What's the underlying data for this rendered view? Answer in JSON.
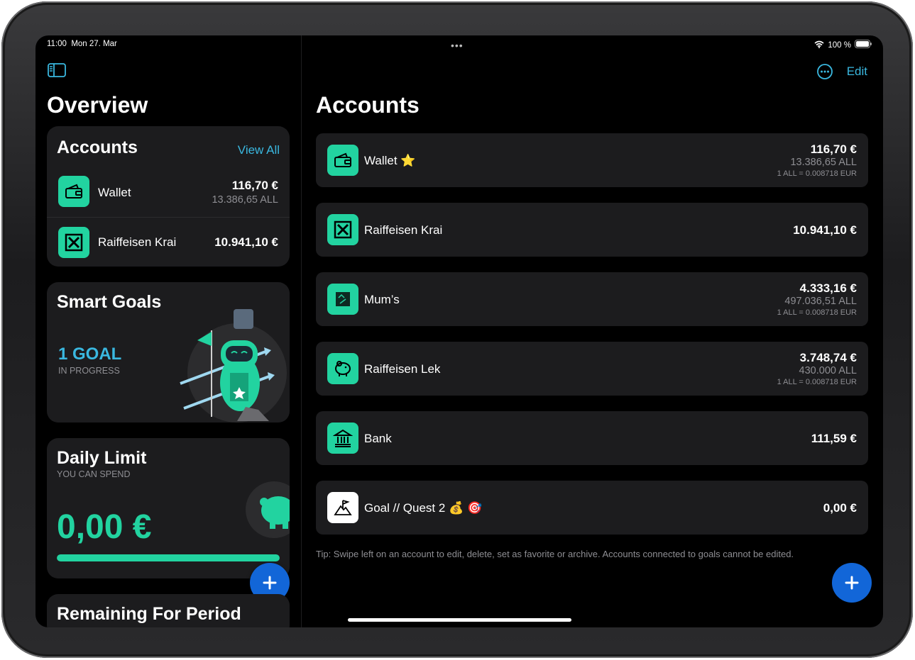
{
  "status": {
    "time": "11:00",
    "date": "Mon 27. Mar",
    "battery": "100 %"
  },
  "sidebar": {
    "title": "Overview",
    "accounts_card": {
      "title": "Accounts",
      "view_all": "View All",
      "items": [
        {
          "name": "Wallet",
          "amount": "116,70 €",
          "sub": "13.386,65 ALL"
        },
        {
          "name": "Raiffeisen Krai",
          "amount": "10.941,10 €"
        }
      ]
    },
    "smart_goals": {
      "title": "Smart Goals",
      "count": "1 GOAL",
      "status": "IN PROGRESS"
    },
    "daily_limit": {
      "title": "Daily Limit",
      "subtitle": "YOU CAN SPEND",
      "amount": "0,00 €",
      "progress": 1.0
    },
    "remaining": {
      "title": "Remaining For Period"
    }
  },
  "header": {
    "edit": "Edit"
  },
  "detail": {
    "title": "Accounts",
    "accounts": [
      {
        "name": "Wallet ⭐",
        "icon": "wallet-icon",
        "amount": "116,70 €",
        "sub": "13.386,65 ALL",
        "rate": "1 ALL = 0.008718 EUR"
      },
      {
        "name": "Raiffeisen Krai",
        "icon": "raiffeisen-icon",
        "amount": "10.941,10 €"
      },
      {
        "name": "Mum’s",
        "icon": "photo-icon",
        "amount": "4.333,16 €",
        "sub": "497.036,51 ALL",
        "rate": "1 ALL = 0.008718 EUR"
      },
      {
        "name": "Raiffeisen Lek",
        "icon": "piggy-bank-icon",
        "amount": "3.748,74 €",
        "sub": "430.000 ALL",
        "rate": "1 ALL = 0.008718 EUR"
      },
      {
        "name": "Bank",
        "icon": "bank-icon",
        "amount": "111,59 €"
      },
      {
        "name": "Goal // Quest 2 💰 🎯",
        "icon": "goal-flag-icon",
        "amount": "0,00 €"
      }
    ],
    "tip": "Tip: Swipe left on an account to edit, delete, set as favorite or archive. Accounts connected to goals cannot be edited."
  },
  "colors": {
    "accent": "#22d3a0",
    "link": "#3ab8e0",
    "fab": "#1266d8",
    "card": "#1c1c1e"
  }
}
